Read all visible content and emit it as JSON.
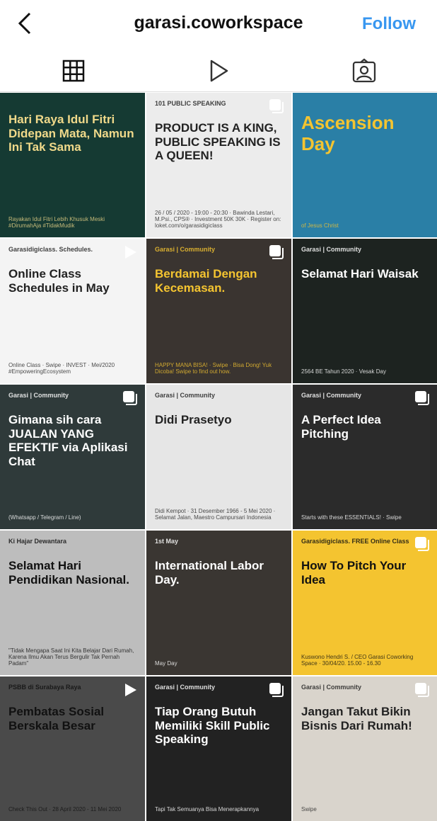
{
  "header": {
    "title": "garasi.coworkspace",
    "follow_label": "Follow",
    "back_icon": "chevron-left-icon"
  },
  "tabs": [
    {
      "name": "grid",
      "icon": "grid-icon",
      "active": true
    },
    {
      "name": "reels",
      "icon": "play-icon"
    },
    {
      "name": "tagged",
      "icon": "tagged-user-icon"
    }
  ],
  "colors": {
    "accent": "#3897f0",
    "yellow": "#f4c430"
  },
  "posts": [
    {
      "bg": "#153a33",
      "fg": "#f0d98a",
      "main": "Hari Raya Idul Fitri Didepan Mata, Namun Ini Tak Sama",
      "sub": "Rayakan Idul Fitri Lebih Khusuk Meski #DirumahAja #TidakMudik",
      "badge": "none"
    },
    {
      "bg": "#ececec",
      "fg": "#222",
      "tag": "101 PUBLIC SPEAKING",
      "main": "PRODUCT IS A KING, PUBLIC SPEAKING IS A QUEEN!",
      "sub": "26 / 05 / 2020 - 19:00 - 20:30 · Bawinda Lestari, M.Psi., CPS® · Investment 50K 30K · Register on: loket.com/o/garasidigiclass",
      "badge": "multi"
    },
    {
      "bg": "#2a7fa6",
      "fg": "#f4c430",
      "main": "Ascension Day",
      "sub": "of Jesus Christ",
      "badge": "none"
    },
    {
      "bg": "#f4f4f4",
      "fg": "#222",
      "tag": "Garasidigiclass.   Schedules.",
      "main": "Online Class Schedules in May",
      "sub": "Online Class · Swipe · INVEST · Mei/2020 #EmpoweringEcosystem",
      "badge": "video"
    },
    {
      "bg": "#3a3430",
      "fg": "#f4c430",
      "tag": "Garasi | Community",
      "main": "Berdamai Dengan Kecemasan.",
      "sub": "HAPPY MANA BISA! · Swipe · Bisa Dong! Yuk Dicoba! Swipe to find out how.",
      "badge": "multi"
    },
    {
      "bg": "#1d2320",
      "fg": "#fff",
      "tag": "Garasi | Community",
      "main": "Selamat Hari Waisak",
      "sub": "2564 BE Tahun 2020 · Vesak Day",
      "badge": "none"
    },
    {
      "bg": "#2f3a3a",
      "fg": "#fff",
      "tag": "Garasi | Community",
      "main": "Gimana sih cara JUALAN YANG EFEKTIF via Aplikasi Chat",
      "sub": "(Whatsapp / Telegram / Line)",
      "badge": "multi"
    },
    {
      "bg": "#e6e6e6",
      "fg": "#222",
      "tag": "Garasi | Community",
      "main": "Didi Prasetyo",
      "sub": "Didi Kempot · 31 Desember 1966 - 5 Mei 2020 · Selamat Jalan, Maestro Campursari Indonesia",
      "badge": "none"
    },
    {
      "bg": "#2b2b2b",
      "fg": "#fff",
      "tag": "Garasi | Community",
      "main": "A Perfect Idea Pitching",
      "sub": "Starts with these ESSENTIALS! · Swipe",
      "badge": "multi"
    },
    {
      "bg": "#bdbdbd",
      "fg": "#111",
      "tag": "Ki Hajar Dewantara",
      "main": "Selamat Hari Pendidikan Nasional.",
      "sub": "\"Tidak Mengapa Saat Ini Kita Belajar Dari Rumah, Karena Ilmu Akan Terus Bergulir Tak Pernah Padam\"",
      "badge": "none"
    },
    {
      "bg": "#3a3632",
      "fg": "#fff",
      "tag": "1st May",
      "main": "International Labor Day.",
      "sub": "May Day",
      "badge": "none"
    },
    {
      "bg": "#f4c430",
      "fg": "#111",
      "tag": "Garasidigiclass. FREE Online Class",
      "main": "How To Pitch Your Idea",
      "sub": "Kuswono Hendri S. / CEO Garasi Coworking Space · 30/04/20. 15.00 - 16.30",
      "badge": "multi"
    },
    {
      "bg": "#4a4a4a",
      "fg": "#111",
      "tag": "PSBB di Surabaya Raya",
      "main": "Pembatas Sosial Berskala Besar",
      "sub": "Check This Out · 28 April 2020 - 11 Mei 2020",
      "badge": "video"
    },
    {
      "bg": "#222",
      "fg": "#fff",
      "tag": "Garasi | Community",
      "main": "Tiap Orang Butuh Memiliki Skill Public Speaking",
      "sub": "Tapi Tak Semuanya Bisa Menerapkannya",
      "badge": "multi"
    },
    {
      "bg": "#d9d4cc",
      "fg": "#222",
      "tag": "Garasi | Community",
      "main": "Jangan Takut Bikin Bisnis Dari Rumah!",
      "sub": "Swipe",
      "badge": "multi"
    }
  ]
}
